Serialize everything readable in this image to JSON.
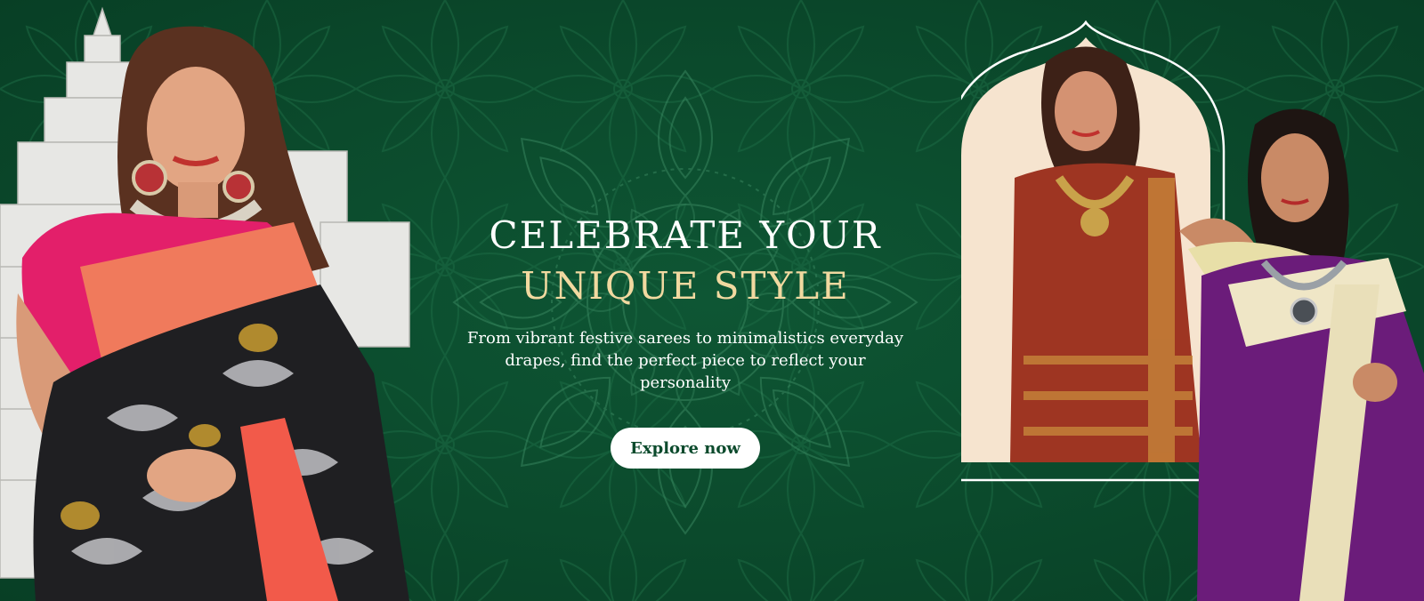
{
  "banner": {
    "headline_line1": "CELEBRATE YOUR",
    "headline_line2": "UNIQUE STYLE",
    "subtext": "From vibrant festive sarees to minimalistics everyday drapes, find the perfect piece to reflect your personality",
    "cta_label": "Explore now"
  },
  "colors": {
    "background": "#0b4a2c",
    "accent_gold": "#f1d9a0",
    "text_white": "#ffffff",
    "arch_fill": "#f6e4cf"
  },
  "icons": [
    "lotus-pattern",
    "mandala-motif",
    "temple-illustration",
    "arch-frame"
  ]
}
